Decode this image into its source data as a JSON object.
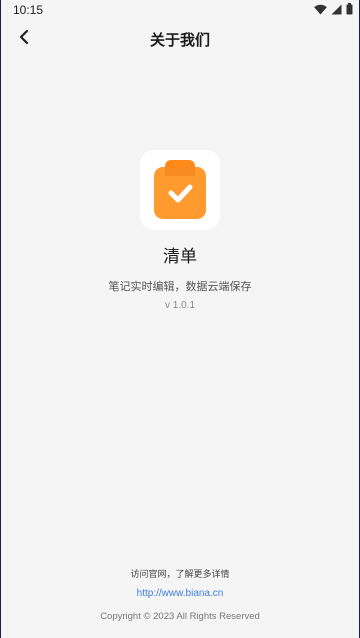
{
  "status_bar": {
    "time": "10:15",
    "icons": [
      "wifi-icon",
      "cellular-icon",
      "battery-icon"
    ]
  },
  "header": {
    "back_icon": "chevron-left-icon",
    "title": "关于我们"
  },
  "app": {
    "logo_icon": "clipboard-check-icon",
    "name": "清单",
    "description": "笔记实时编辑，数据云端保存",
    "version": "v 1.0.1"
  },
  "footer": {
    "hint": "访问官网，了解更多详情",
    "link": "http://www.biana.cn",
    "copyright": "Copyright © 2023 All Rights Reserved"
  },
  "colors": {
    "background": "#f5f5f5",
    "logo_orange": "#ff9a2e",
    "logo_orange_dark": "#ff8a1a",
    "link_blue": "#3b7fe0"
  }
}
